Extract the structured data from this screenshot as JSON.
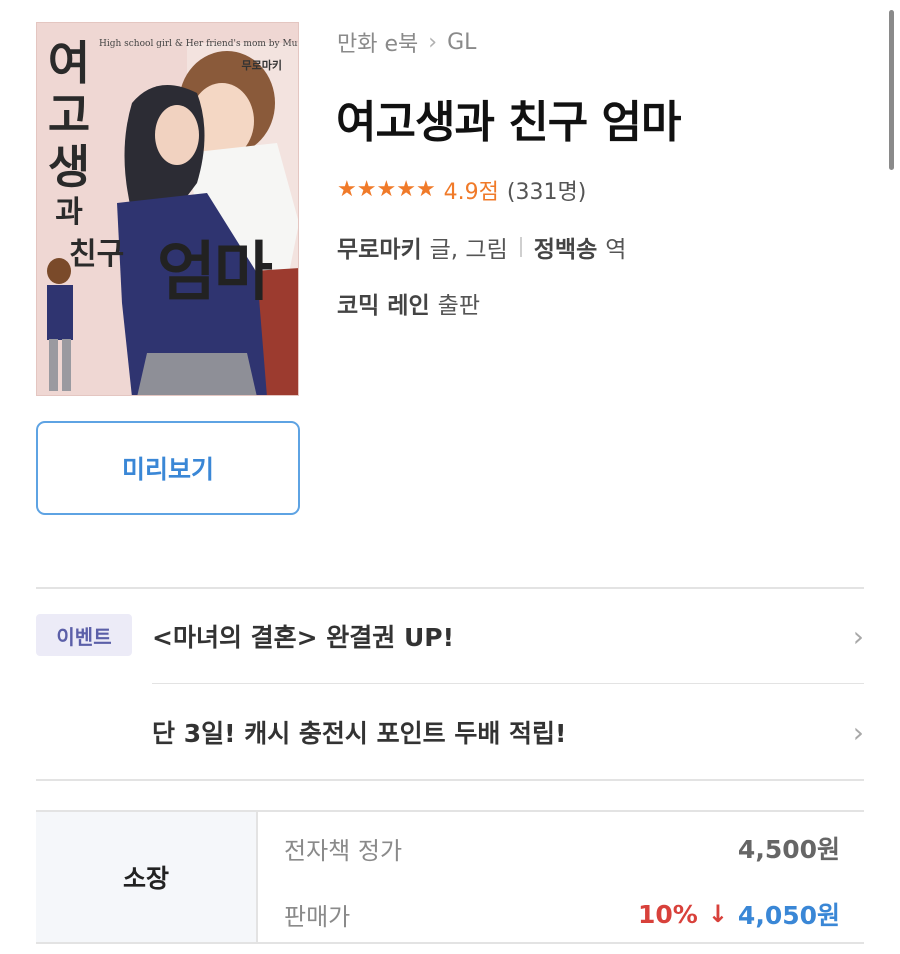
{
  "breadcrumb": {
    "category": "만화 e북",
    "separator": "›",
    "genre": "GL"
  },
  "book": {
    "title": "여고생과 친구 엄마",
    "cover": {
      "title_chars": [
        "여",
        "고",
        "생"
      ],
      "title_small": "과",
      "friend": "친구",
      "mom": "엄마",
      "subtitle": "High school girl & Her friend's mom by Muromaki",
      "author": "무로마키"
    }
  },
  "rating": {
    "stars": 5,
    "score_text": "4.9점",
    "count_text": "(331명)",
    "star_color": "#f07a29"
  },
  "authors": [
    {
      "name": "무로마키",
      "role": "글, 그림"
    },
    {
      "name": "정백송",
      "role": "역"
    }
  ],
  "publisher": {
    "name": "코믹 레인",
    "role": "출판"
  },
  "preview_button": "미리보기",
  "events": {
    "badge": "이벤트",
    "items": [
      {
        "text": "<마녀의 결혼> 완결권 UP!"
      },
      {
        "text": "단 3일! 캐시 충전시 포인트 두배 적립!"
      }
    ],
    "chevron": "›"
  },
  "price": {
    "type_label": "소장",
    "list_label": "전자책 정가",
    "list_value": "4,500원",
    "sale_label": "판매가",
    "discount": "10%",
    "discount_arrow": "↓",
    "sale_value": "4,050원",
    "accent_blue": "#3a87d6",
    "accent_red": "#d8413b"
  }
}
